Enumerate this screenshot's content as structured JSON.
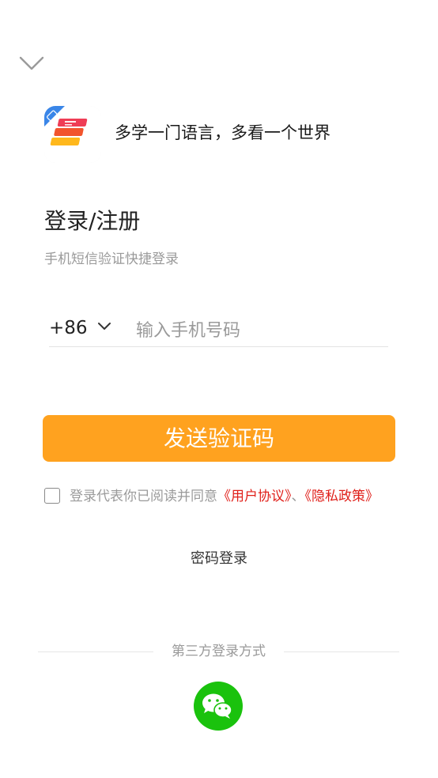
{
  "header": {
    "slogan": "多学一门语言，多看一个世界"
  },
  "login": {
    "title": "登录/注册",
    "subtitle": "手机短信验证快捷登录",
    "country_code": "+86",
    "phone_placeholder": "输入手机号码",
    "phone_value": "",
    "send_code_label": "发送验证码"
  },
  "agreement": {
    "checked": false,
    "prefix": "登录代表你已阅读并同意",
    "user_agreement": "《用户协议》",
    "separator": "、",
    "privacy_policy": "《隐私政策》"
  },
  "password_login_label": "密码登录",
  "third_party": {
    "label": "第三方登录方式",
    "providers": [
      "wechat-icon"
    ]
  },
  "colors": {
    "accent": "#ffa21f",
    "link": "#e0201a",
    "wechat": "#1ac20d",
    "muted_text": "#9a9a9a"
  }
}
